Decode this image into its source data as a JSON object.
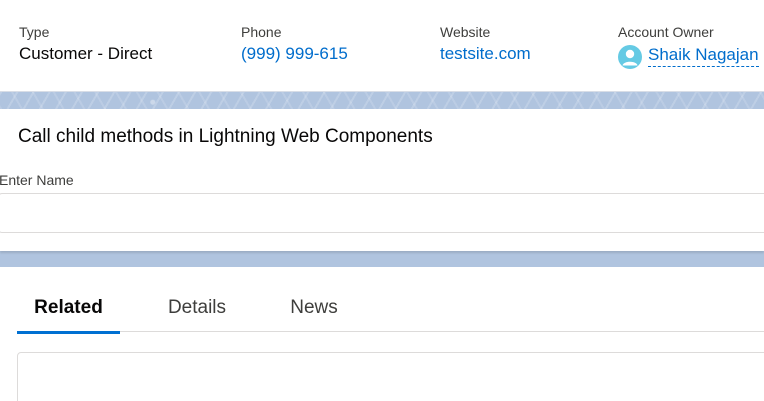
{
  "highlights": {
    "type": {
      "label": "Type",
      "value": "Customer - Direct"
    },
    "phone": {
      "label": "Phone",
      "value": "(999) 999-615"
    },
    "website": {
      "label": "Website",
      "value": "testsite.com"
    },
    "owner": {
      "label": "Account Owner",
      "value": "Shaik Nagajan",
      "avatar_icon": "user-avatar-icon",
      "avatar_color": "#65cae4"
    }
  },
  "lwc_card": {
    "title": "Call child methods in Lightning Web Components",
    "input_label": "Enter Name",
    "input_value": ""
  },
  "tabs": {
    "items": [
      {
        "label": "Related",
        "active": true
      },
      {
        "label": "Details",
        "active": false
      },
      {
        "label": "News",
        "active": false
      }
    ]
  },
  "colors": {
    "link": "#006dcc",
    "tab_active_underline": "#0070d2",
    "background": "#b0c4df"
  }
}
